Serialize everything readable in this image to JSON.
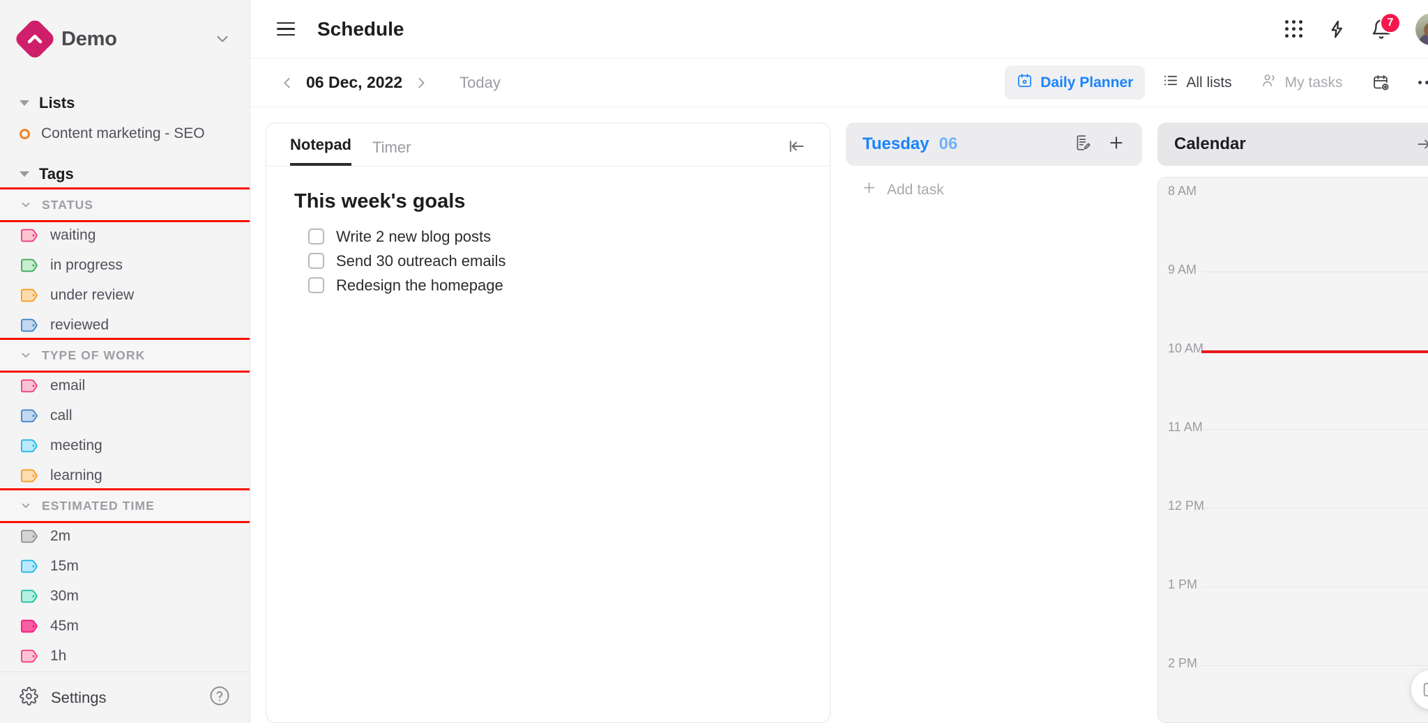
{
  "sidebar": {
    "brand": {
      "name": "Demo",
      "logo_color": "#cf1f6a",
      "caret_icon": "chevron-down-icon"
    },
    "lists_section": {
      "label": "Lists",
      "items": [
        {
          "label": "Content marketing - SEO",
          "dot_color": "#f58220"
        }
      ]
    },
    "tags_section": {
      "label": "Tags",
      "groups": [
        {
          "label": "STATUS",
          "highlighted": true,
          "tags": [
            {
              "label": "waiting",
              "fill": "#fbc4d2",
              "stroke": "#f2387c"
            },
            {
              "label": "in progress",
              "fill": "#c9edcf",
              "stroke": "#3aa85a"
            },
            {
              "label": "under review",
              "fill": "#fcdcb0",
              "stroke": "#f59b1d"
            },
            {
              "label": "reviewed",
              "fill": "#c3d8ef",
              "stroke": "#3b82c4"
            }
          ]
        },
        {
          "label": "TYPE OF WORK",
          "highlighted": true,
          "tags": [
            {
              "label": "email",
              "fill": "#fbc4d2",
              "stroke": "#f2387c"
            },
            {
              "label": "call",
              "fill": "#c3d8ef",
              "stroke": "#3b82c4"
            },
            {
              "label": "meeting",
              "fill": "#b9e9fb",
              "stroke": "#17b6e8"
            },
            {
              "label": "learning",
              "fill": "#fcdcb0",
              "stroke": "#f59b1d"
            }
          ]
        },
        {
          "label": "ESTIMATED TIME",
          "highlighted": true,
          "tags": [
            {
              "label": "2m",
              "fill": "#d4d4d6",
              "stroke": "#8e8e93"
            },
            {
              "label": "15m",
              "fill": "#b9e9fb",
              "stroke": "#17b6e8"
            },
            {
              "label": "30m",
              "fill": "#b6f0e2",
              "stroke": "#18bda0"
            },
            {
              "label": "45m",
              "fill": "#fb5fa1",
              "stroke": "#f2187c"
            },
            {
              "label": "1h",
              "fill": "#fbc4d2",
              "stroke": "#f2387c"
            }
          ]
        }
      ]
    },
    "footer": {
      "settings_label": "Settings",
      "settings_icon": "gear-icon",
      "help_icon": "help-circle-icon"
    }
  },
  "header": {
    "menu_icon": "hamburger-icon",
    "title": "Schedule",
    "apps_icon": "grid-apps-icon",
    "automation_icon": "lightning-bolt-icon",
    "notifications_icon": "bell-icon",
    "notifications_count": "7",
    "avatar_icon": "user-avatar"
  },
  "toolbar": {
    "prev_icon": "chevron-left-icon",
    "date": "06 Dec, 2022",
    "next_icon": "chevron-right-icon",
    "today_label": "Today",
    "views": [
      {
        "label": "Daily Planner",
        "icon": "calendar-day-icon",
        "active": true
      },
      {
        "label": "All lists",
        "icon": "list-icon",
        "active": false
      },
      {
        "label": "My tasks",
        "icon": "people-icon",
        "active": false
      }
    ],
    "add_calendar_icon": "calendar-plus-icon",
    "more_icon": "ellipsis-icon"
  },
  "notepad": {
    "tabs": [
      {
        "label": "Notepad",
        "active": true
      },
      {
        "label": "Timer",
        "active": false
      }
    ],
    "collapse_icon": "collapse-left-icon",
    "note_title": "This week's goals",
    "checklist": [
      {
        "label": "Write 2 new blog posts",
        "checked": false
      },
      {
        "label": "Send 30 outreach emails",
        "checked": false
      },
      {
        "label": "Redesign the homepage",
        "checked": false
      }
    ]
  },
  "day_panel": {
    "day_name": "Tuesday",
    "day_number": "06",
    "note_icon": "note-edit-icon",
    "add_icon": "plus-icon",
    "add_task_label": "Add task"
  },
  "calendar_panel": {
    "title": "Calendar",
    "expand_icon": "expand-right-icon",
    "hours": [
      "8 AM",
      "9 AM",
      "10 AM",
      "11 AM",
      "12 PM",
      "1 PM",
      "2 PM"
    ],
    "current_time_hour": "10 AM",
    "current_time_color": "#ea1717"
  },
  "fab": {
    "icon": "compose-edit-icon"
  }
}
